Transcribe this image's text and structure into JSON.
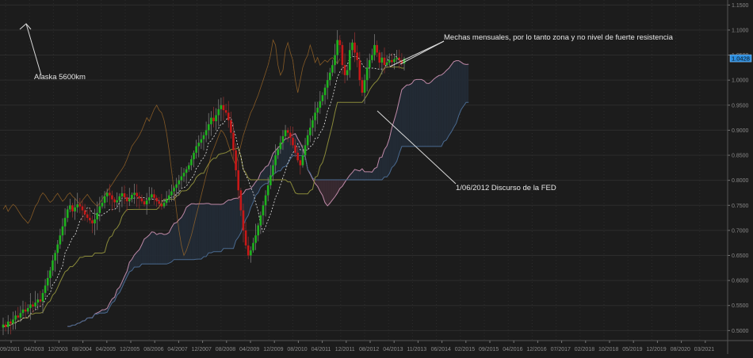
{
  "chart_data": {
    "type": "candlestick",
    "ylim": [
      0.48,
      1.16
    ],
    "y_ticks": [
      0.5,
      0.55,
      0.6,
      0.65,
      0.7,
      0.75,
      0.8,
      0.85,
      0.9,
      0.95,
      1.0,
      1.05,
      1.1,
      1.15
    ],
    "y_tick_labels": [
      "0.5000",
      "0.5500",
      "0.6000",
      "0.6500",
      "0.7000",
      "0.7500",
      "0.8000",
      "0.8500",
      "0.9000",
      "0.9500",
      "1.0000",
      "1.0500",
      "1.1000",
      "1.1500"
    ],
    "x_tick_labels": [
      "09/2001",
      "04/2003",
      "12/2003",
      "08/2004",
      "04/2005",
      "12/2005",
      "08/2006",
      "04/2007",
      "12/2007",
      "08/2008",
      "04/2009",
      "12/2009",
      "08/2010",
      "04/2011",
      "12/2011",
      "08/2012",
      "04/2013",
      "11/2013",
      "06/2014",
      "02/2015",
      "09/2015",
      "04/2016",
      "12/2016",
      "07/2017",
      "02/2018",
      "10/2018",
      "05/2019",
      "12/2019",
      "08/2020",
      "03/2021"
    ],
    "last_price_label": "1.0428",
    "last_price": 1.0428,
    "grid": true,
    "closes": [
      0.512,
      0.507,
      0.518,
      0.514,
      0.522,
      0.53,
      0.526,
      0.535,
      0.542,
      0.538,
      0.545,
      0.552,
      0.548,
      0.556,
      0.562,
      0.558,
      0.575,
      0.59,
      0.605,
      0.62,
      0.64,
      0.655,
      0.672,
      0.69,
      0.708,
      0.725,
      0.742,
      0.75,
      0.738,
      0.746,
      0.752,
      0.748,
      0.74,
      0.732,
      0.725,
      0.72,
      0.714,
      0.722,
      0.735,
      0.748,
      0.755,
      0.768,
      0.775,
      0.77,
      0.762,
      0.756,
      0.76,
      0.768,
      0.774,
      0.766,
      0.758,
      0.763,
      0.771,
      0.775,
      0.768,
      0.764,
      0.758,
      0.752,
      0.76,
      0.766,
      0.772,
      0.765,
      0.758,
      0.753,
      0.748,
      0.755,
      0.762,
      0.77,
      0.778,
      0.785,
      0.792,
      0.8,
      0.808,
      0.815,
      0.822,
      0.83,
      0.842,
      0.855,
      0.868,
      0.875,
      0.882,
      0.89,
      0.9,
      0.912,
      0.925,
      0.918,
      0.93,
      0.942,
      0.95,
      0.94,
      0.935,
      0.92,
      0.895,
      0.86,
      0.82,
      0.78,
      0.74,
      0.7,
      0.67,
      0.65,
      0.66,
      0.675,
      0.69,
      0.71,
      0.73,
      0.75,
      0.77,
      0.79,
      0.81,
      0.83,
      0.85,
      0.862,
      0.875,
      0.888,
      0.9,
      0.895,
      0.885,
      0.87,
      0.855,
      0.84,
      0.83,
      0.85,
      0.87,
      0.89,
      0.905,
      0.92,
      0.935,
      0.945,
      0.958,
      0.97,
      0.985,
      1.0,
      1.015,
      1.03,
      1.05,
      1.08,
      1.07,
      1.03,
      1.01,
      1.02,
      1.06,
      1.075,
      1.055,
      1.04,
      1.0,
      0.975,
      1.0,
      1.025,
      1.04,
      1.05,
      1.07,
      1.055,
      1.035,
      1.045,
      1.03,
      1.035,
      1.04,
      1.036,
      1.042,
      1.045,
      1.04,
      1.033,
      1.0428
    ],
    "ichimoku": {
      "tenkan": "dashed white line",
      "kijun": "olive line",
      "chikou": "orange line",
      "senkou_span_a": "pink line",
      "senkou_span_b": "steel-blue line"
    }
  },
  "annotations": {
    "alaska": "Alaska 5600km",
    "mechas": "Mechas mensuales, por lo tanto zona y no nivel de fuerte resistencia",
    "fed": "1/06/2012 Discurso de la FED"
  },
  "colors": {
    "background": "#1c1c1c",
    "grid": "#2c2c2c",
    "bull": "#1fb31f",
    "bear": "#c81818",
    "tenkan": "#e8e8e8",
    "kijun": "#8a8a3a",
    "chikou": "#b0742a",
    "span_a": "#c08aa8",
    "span_b": "#4a6a90",
    "cloud_bull": "#232b36",
    "cloud_bear": "#3a2a32",
    "price_tag": "#2b8ee0"
  }
}
